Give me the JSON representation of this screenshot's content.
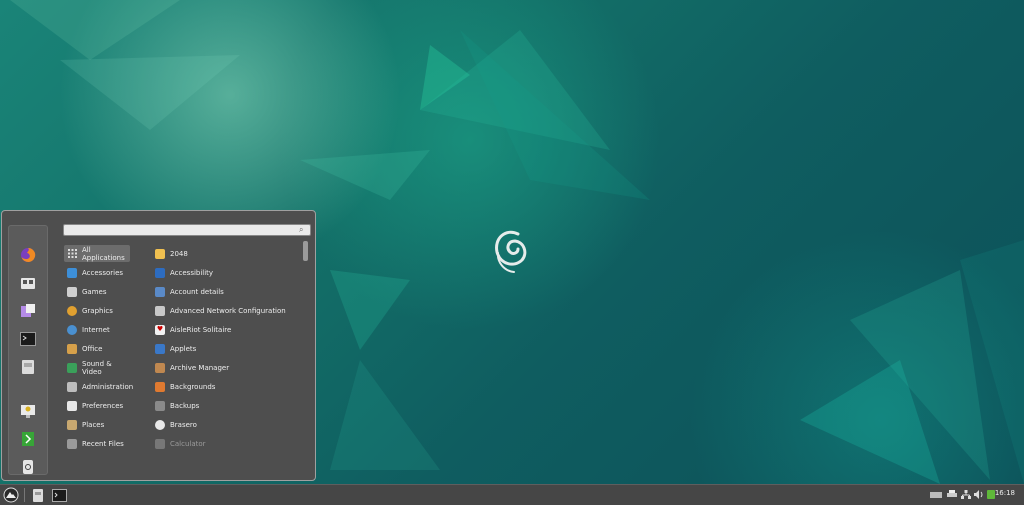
{
  "menu": {
    "search": {
      "value": "",
      "placeholder": ""
    },
    "favorites": [
      {
        "name": "firefox-icon",
        "color": "#e8702a"
      },
      {
        "name": "software-manager-icon",
        "color": "#dddddd"
      },
      {
        "name": "settings-icon",
        "color": "#c2a0f0"
      },
      {
        "name": "terminal-icon",
        "color": "#222222"
      },
      {
        "name": "files-icon",
        "color": "#d8d8d8"
      },
      {
        "name": "lock-screen-icon",
        "color": "#e4c040"
      },
      {
        "name": "logout-icon",
        "color": "#3aa83a"
      },
      {
        "name": "shutdown-icon",
        "color": "#dddddd"
      }
    ],
    "categories": [
      {
        "label": "All Applications",
        "icon": "grid-icon"
      },
      {
        "label": "Accessories",
        "icon": "accessories-icon"
      },
      {
        "label": "Games",
        "icon": "games-icon"
      },
      {
        "label": "Graphics",
        "icon": "graphics-icon"
      },
      {
        "label": "Internet",
        "icon": "internet-icon"
      },
      {
        "label": "Office",
        "icon": "office-icon"
      },
      {
        "label": "Sound & Video",
        "icon": "sound-video-icon"
      },
      {
        "label": "Administration",
        "icon": "administration-icon"
      },
      {
        "label": "Preferences",
        "icon": "preferences-icon"
      },
      {
        "label": "Places",
        "icon": "folder-icon"
      },
      {
        "label": "Recent Files",
        "icon": "recent-files-icon"
      }
    ],
    "apps": [
      {
        "label": "2048",
        "icon": "game-2048-icon"
      },
      {
        "label": "Accessibility",
        "icon": "accessibility-icon"
      },
      {
        "label": "Account details",
        "icon": "account-icon"
      },
      {
        "label": "Advanced Network Configuration",
        "icon": "network-config-icon"
      },
      {
        "label": "AisleRiot Solitaire",
        "icon": "solitaire-icon"
      },
      {
        "label": "Applets",
        "icon": "applets-icon"
      },
      {
        "label": "Archive Manager",
        "icon": "archive-icon"
      },
      {
        "label": "Backgrounds",
        "icon": "backgrounds-icon"
      },
      {
        "label": "Backups",
        "icon": "backups-icon"
      },
      {
        "label": "Brasero",
        "icon": "brasero-icon"
      },
      {
        "label": "Calculator",
        "icon": "calculator-icon"
      }
    ]
  },
  "panel": {
    "clock": "16:18",
    "tray": [
      "display-icon",
      "printer-icon",
      "network-icon",
      "volume-icon",
      "update-icon"
    ]
  }
}
